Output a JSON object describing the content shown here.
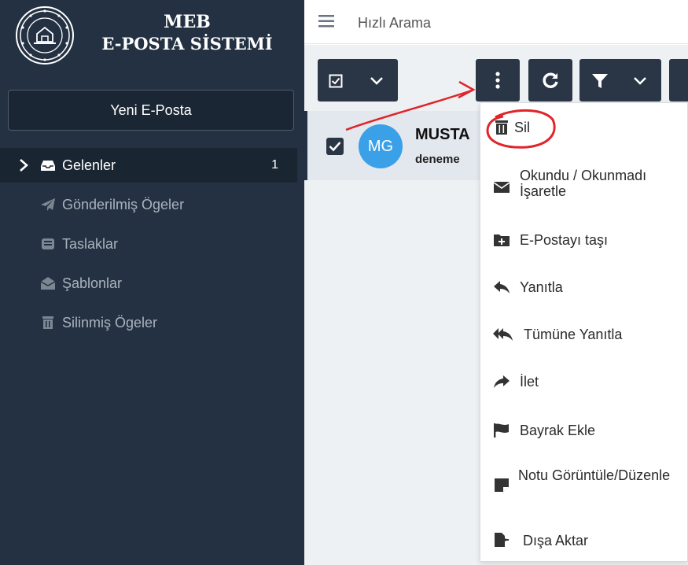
{
  "sidebar": {
    "brand_line1": "MEB",
    "brand_line2": "E-POSTA SİSTEMİ",
    "new_mail_label": "Yeni E-Posta",
    "items": [
      {
        "label": "Gelenler",
        "count": "1",
        "icon": "inbox-icon",
        "active": true
      },
      {
        "label": "Gönderilmiş Ögeler",
        "icon": "paper-plane-icon"
      },
      {
        "label": "Taslaklar",
        "icon": "drafts-icon"
      },
      {
        "label": "Şablonlar",
        "icon": "open-envelope-icon"
      },
      {
        "label": "Silinmiş Ögeler",
        "icon": "trash-icon"
      }
    ]
  },
  "topbar": {
    "search_placeholder": "Hızlı Arama"
  },
  "toolbar": {
    "buttons": [
      "select-all-checkbox",
      "select-dropdown",
      "more-actions",
      "refresh",
      "filter",
      "filter-dropdown"
    ]
  },
  "mail_list": {
    "rows": [
      {
        "avatar_initials": "MG",
        "sender": "MUSTA",
        "subject": "deneme",
        "checked": true
      }
    ]
  },
  "actions_menu": {
    "items": [
      {
        "label": "Sil",
        "icon": "trash-icon"
      },
      {
        "label": "Okundu / Okunmadı İşaretle",
        "icon": "envelope-icon"
      },
      {
        "label": "E-Postayı taşı",
        "icon": "folder-plus-icon"
      },
      {
        "label": "Yanıtla",
        "icon": "reply-icon"
      },
      {
        "label": "Tümüne Yanıtla",
        "icon": "reply-all-icon"
      },
      {
        "label": "İlet",
        "icon": "share-icon"
      },
      {
        "label": "Bayrak Ekle",
        "icon": "flag-icon"
      },
      {
        "label": "Notu Görüntüle/Düzenle",
        "icon": "sticky-note-icon"
      },
      {
        "label": "Dışa Aktar",
        "icon": "file-export-icon"
      }
    ]
  },
  "colors": {
    "sidebar_bg": "#233142",
    "active_bg": "#1a2532",
    "avatar_bg": "#3aa0e8",
    "annotation_red": "#e0242a"
  }
}
